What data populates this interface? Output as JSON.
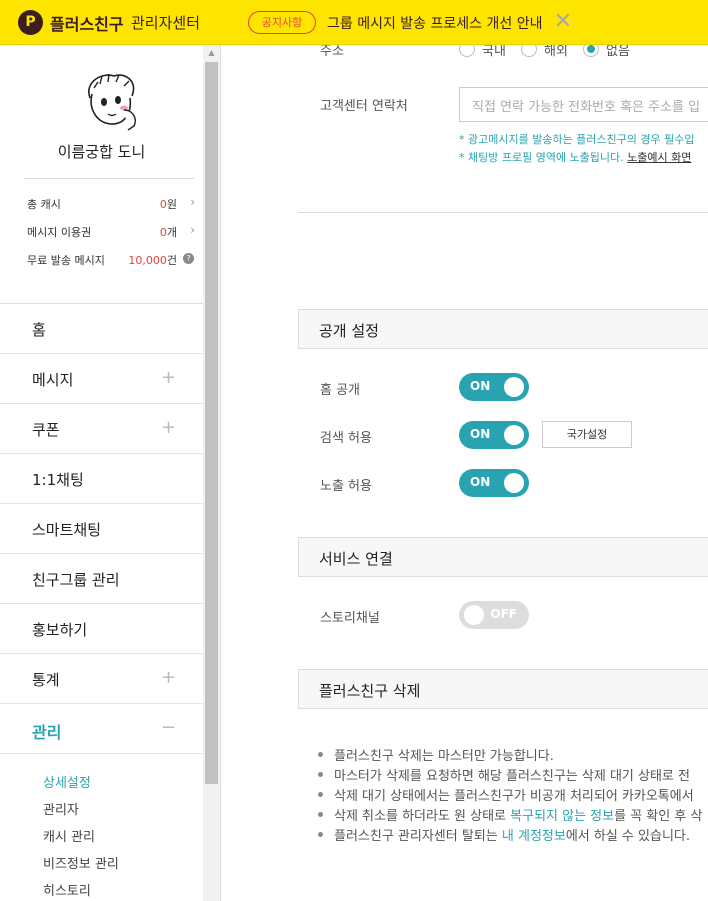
{
  "topbar": {
    "logo_glyph": "P",
    "brand": "플러스친구",
    "brand_sub": "관리자센터",
    "notice_badge": "공지사항",
    "notice_text": "그룹 메시지 발송 프로세스 개선 안내",
    "close_glyph": "✕"
  },
  "profile": {
    "name": "이름궁합 도니"
  },
  "stats": [
    {
      "label": "총 캐시",
      "value": "0",
      "unit": "원"
    },
    {
      "label": "메시지 이용권",
      "value": "0",
      "unit": "개"
    },
    {
      "label": "무료 발송 메시지",
      "value": "10,000",
      "unit": "건"
    }
  ],
  "menu": [
    {
      "label": "홈",
      "expandable": false
    },
    {
      "label": "메시지",
      "expandable": true,
      "sign": "+"
    },
    {
      "label": "쿠폰",
      "expandable": true,
      "sign": "+"
    },
    {
      "label": "1:1채팅",
      "expandable": false
    },
    {
      "label": "스마트채팅",
      "expandable": false
    },
    {
      "label": "친구그룹 관리",
      "expandable": false
    },
    {
      "label": "홍보하기",
      "expandable": false
    },
    {
      "label": "통계",
      "expandable": true,
      "sign": "+"
    },
    {
      "label": "관리",
      "expandable": true,
      "sign": "−",
      "active": true
    }
  ],
  "submenu": [
    {
      "label": "상세설정",
      "active": true
    },
    {
      "label": "관리자"
    },
    {
      "label": "캐시 관리"
    },
    {
      "label": "비즈정보 관리"
    },
    {
      "label": "히스토리"
    }
  ],
  "form": {
    "address_label": "주소",
    "address_options": [
      "국내",
      "해외",
      "없음"
    ],
    "address_selected": "없음",
    "contact_label": "고객센터 연락처",
    "contact_placeholder": "직접 연락 가능한 전화번호 혹은 주소를 입",
    "hint1": "* 광고메시지를 발송하는 플러스친구의 경우 필수입",
    "hint2_prefix": "* 채팅방 프로필 영역에 노출됩니다. ",
    "hint2_link": "노출예시 화면"
  },
  "sections": {
    "public": "공개 설정",
    "service": "서비스 연결",
    "delete": "플러스친구 삭제"
  },
  "public_settings": [
    {
      "label": "홈 공개",
      "state": "ON"
    },
    {
      "label": "검색 허용",
      "state": "ON",
      "button": "국가설정"
    },
    {
      "label": "노출 허용",
      "state": "ON"
    }
  ],
  "service_settings": [
    {
      "label": "스토리채널",
      "state": "OFF"
    }
  ],
  "delete_notes": [
    {
      "text": "플러스친구 삭제는 마스터만 가능합니다."
    },
    {
      "text": "마스터가 삭제를 요청하면 해당 플러스친구는 삭제 대기 상태로 전"
    },
    {
      "text": "삭제 대기 상태에서는 플러스친구가 비공개 처리되어 카카오톡에서"
    },
    {
      "pre": "삭제 취소를 하더라도 원 상태로 ",
      "link": "복구되지 않는 정보",
      "post": "를 꼭 확인 후 삭"
    },
    {
      "pre": "플러스친구 관리자센터 탈퇴는 ",
      "link": "내 계정정보",
      "post": "에서 하실 수 있습니다."
    }
  ],
  "colors": {
    "accent": "#2aa3b0",
    "topbar": "#fee500",
    "warn": "#e0453b"
  }
}
